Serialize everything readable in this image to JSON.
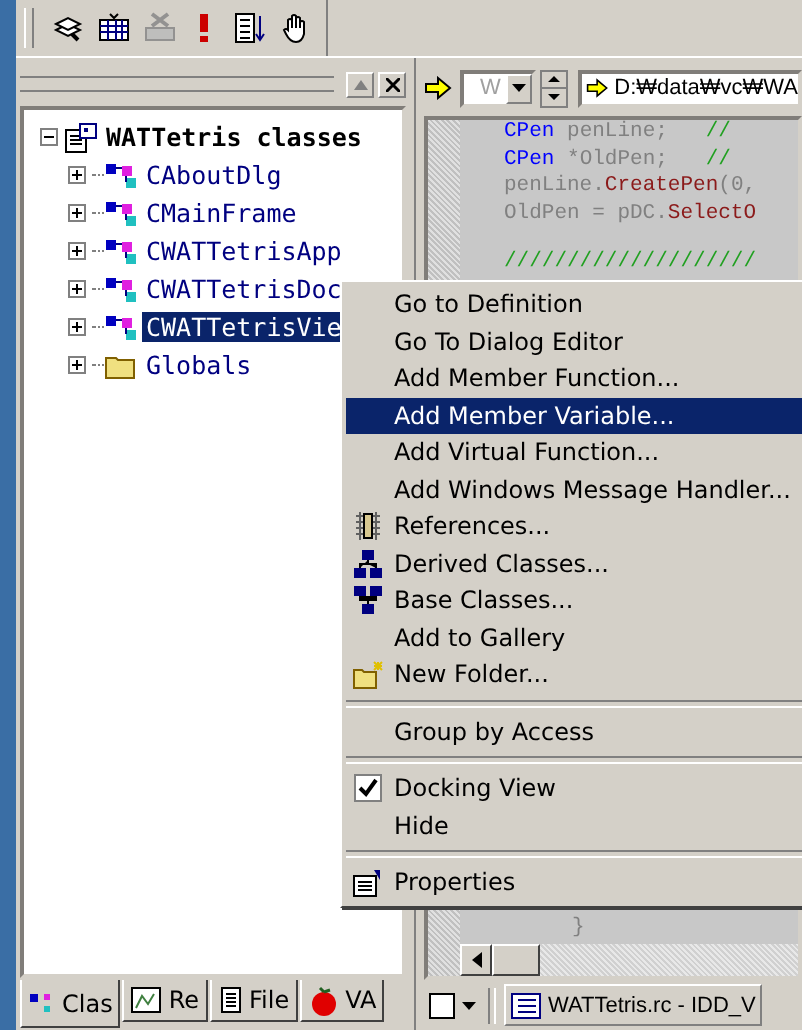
{
  "toolbar": [
    {
      "kind": "stack",
      "disabled": false
    },
    {
      "kind": "grid",
      "disabled": false
    },
    {
      "kind": "delete",
      "disabled": true
    },
    {
      "kind": "exclaim",
      "disabled": false
    },
    {
      "kind": "sort",
      "disabled": false
    },
    {
      "kind": "hand",
      "disabled": false
    }
  ],
  "class_view": {
    "root": {
      "label": "WATTetris classes",
      "expanded": true,
      "children": [
        {
          "label": "CAboutDlg",
          "kind": "class",
          "selected": false
        },
        {
          "label": "CMainFrame",
          "kind": "class",
          "selected": false
        },
        {
          "label": "CWATTetrisApp",
          "kind": "class",
          "selected": false
        },
        {
          "label": "CWATTetrisDoc",
          "kind": "class",
          "selected": false
        },
        {
          "label": "CWATTetrisVie",
          "kind": "class",
          "selected": true
        },
        {
          "label": "Globals",
          "kind": "folder",
          "selected": false
        }
      ]
    },
    "tabs": [
      {
        "label": "Clas",
        "kind": "classes",
        "selected": true
      },
      {
        "label": "Re",
        "kind": "resources",
        "selected": false
      },
      {
        "label": "File",
        "kind": "files",
        "selected": false
      },
      {
        "label": "VA",
        "kind": "tomato",
        "selected": false
      }
    ]
  },
  "navigation": {
    "scope": "W",
    "location": "D:₩data₩vc₩WA"
  },
  "code": {
    "blocks": [
      [
        [
          {
            "kind": "keyword",
            "text": "CPen"
          },
          {
            "kind": "plain",
            "text": " penLine;   "
          },
          {
            "kind": "comment",
            "text": "//"
          }
        ],
        [
          {
            "kind": "keyword",
            "text": "CPen"
          },
          {
            "kind": "plain",
            "text": " *OldPen;   "
          },
          {
            "kind": "comment",
            "text": "//"
          }
        ],
        [
          {
            "kind": "plain",
            "text": "penLine."
          },
          {
            "kind": "func",
            "text": "CreatePen"
          },
          {
            "kind": "plain",
            "text": "(0,"
          }
        ],
        [
          {
            "kind": "plain",
            "text": "OldPen = pDC."
          },
          {
            "kind": "func",
            "text": "SelectO"
          }
        ]
      ],
      [
        [
          {
            "kind": "comment",
            "text": "////////////////////"
          }
        ]
      ]
    ],
    "closing": "}"
  },
  "context_menu": {
    "items": [
      {
        "kind": "item",
        "label": "Go to Definition",
        "selected": false
      },
      {
        "kind": "item",
        "label": "Go To Dialog Editor",
        "selected": false
      },
      {
        "kind": "item",
        "label": "Add Member Function...",
        "selected": false
      },
      {
        "kind": "item",
        "label": "Add Member Variable...",
        "selected": true
      },
      {
        "kind": "item",
        "label": "Add Virtual Function...",
        "selected": false
      },
      {
        "kind": "item",
        "label": "Add Windows Message Handler...",
        "selected": false
      },
      {
        "kind": "references",
        "label": "References...",
        "selected": false
      },
      {
        "kind": "derived",
        "label": "Derived Classes...",
        "selected": false
      },
      {
        "kind": "base",
        "label": "Base Classes...",
        "selected": false
      },
      {
        "kind": "item",
        "label": "Add to Gallery",
        "selected": false
      },
      {
        "kind": "folder",
        "label": "New Folder...",
        "selected": false
      },
      {
        "kind": "separator"
      },
      {
        "kind": "item",
        "label": "Group by Access",
        "selected": false
      },
      {
        "kind": "separator"
      },
      {
        "kind": "check",
        "label": "Docking View",
        "checked": true,
        "selected": false
      },
      {
        "kind": "check",
        "label": "Hide",
        "checked": false,
        "selected": false
      },
      {
        "kind": "separator"
      },
      {
        "kind": "properties",
        "label": "Properties",
        "selected": false
      }
    ]
  },
  "output_bar": {
    "document": "WATTetris.rc - IDD_V"
  }
}
